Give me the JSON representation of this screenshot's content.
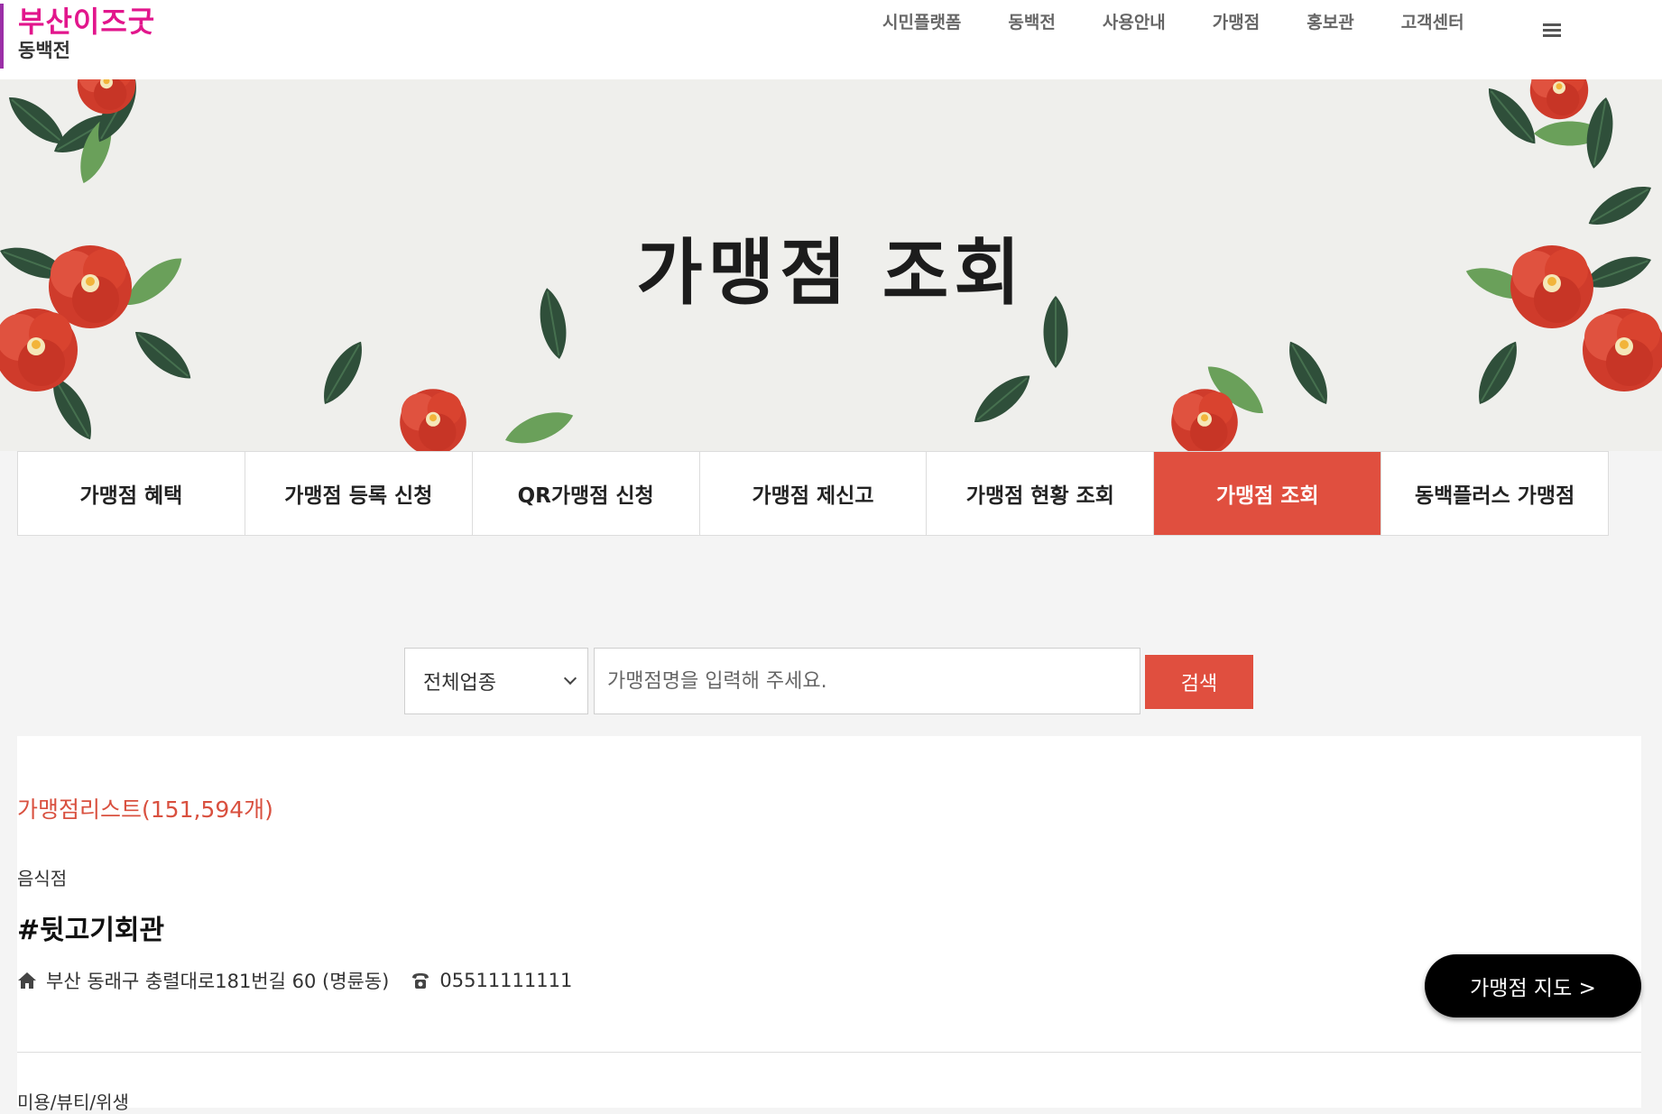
{
  "header": {
    "logo_main": "부산이즈굿",
    "logo_sub": "동백전",
    "nav": [
      "시민플랫폼",
      "동백전",
      "사용안내",
      "가맹점",
      "홍보관",
      "고객센터"
    ]
  },
  "hero": {
    "title": "가맹점 조회"
  },
  "tabs": [
    {
      "label": "가맹점 혜택",
      "active": false
    },
    {
      "label": "가맹점 등록 신청",
      "active": false
    },
    {
      "label": "QR가맹점 신청",
      "active": false
    },
    {
      "label": "가맹점 제신고",
      "active": false
    },
    {
      "label": "가맹점 현황 조회",
      "active": false
    },
    {
      "label": "가맹점 조회",
      "active": true
    },
    {
      "label": "동백플러스 가맹점",
      "active": false
    }
  ],
  "search": {
    "category_selected": "전체업종",
    "placeholder": "가맹점명을 입력해 주세요.",
    "button_label": "검색"
  },
  "results": {
    "count_label": "가맹점리스트(151,594개)",
    "items": [
      {
        "category": "음식점",
        "name": "#뒷고기회관",
        "address": "부산 동래구 충렬대로181번길 60 (명륜동)",
        "phone": "05511111111",
        "map_button": "가맹점 지도 >"
      },
      {
        "category": "미용/뷰티/위생"
      }
    ]
  },
  "colors": {
    "accent": "#e04f3f",
    "logo_pink": "#e2168c",
    "logo_bar": "#9b2fa7"
  },
  "icons": {
    "home": "home-icon",
    "phone": "phone-icon",
    "menu": "hamburger-menu-icon"
  }
}
